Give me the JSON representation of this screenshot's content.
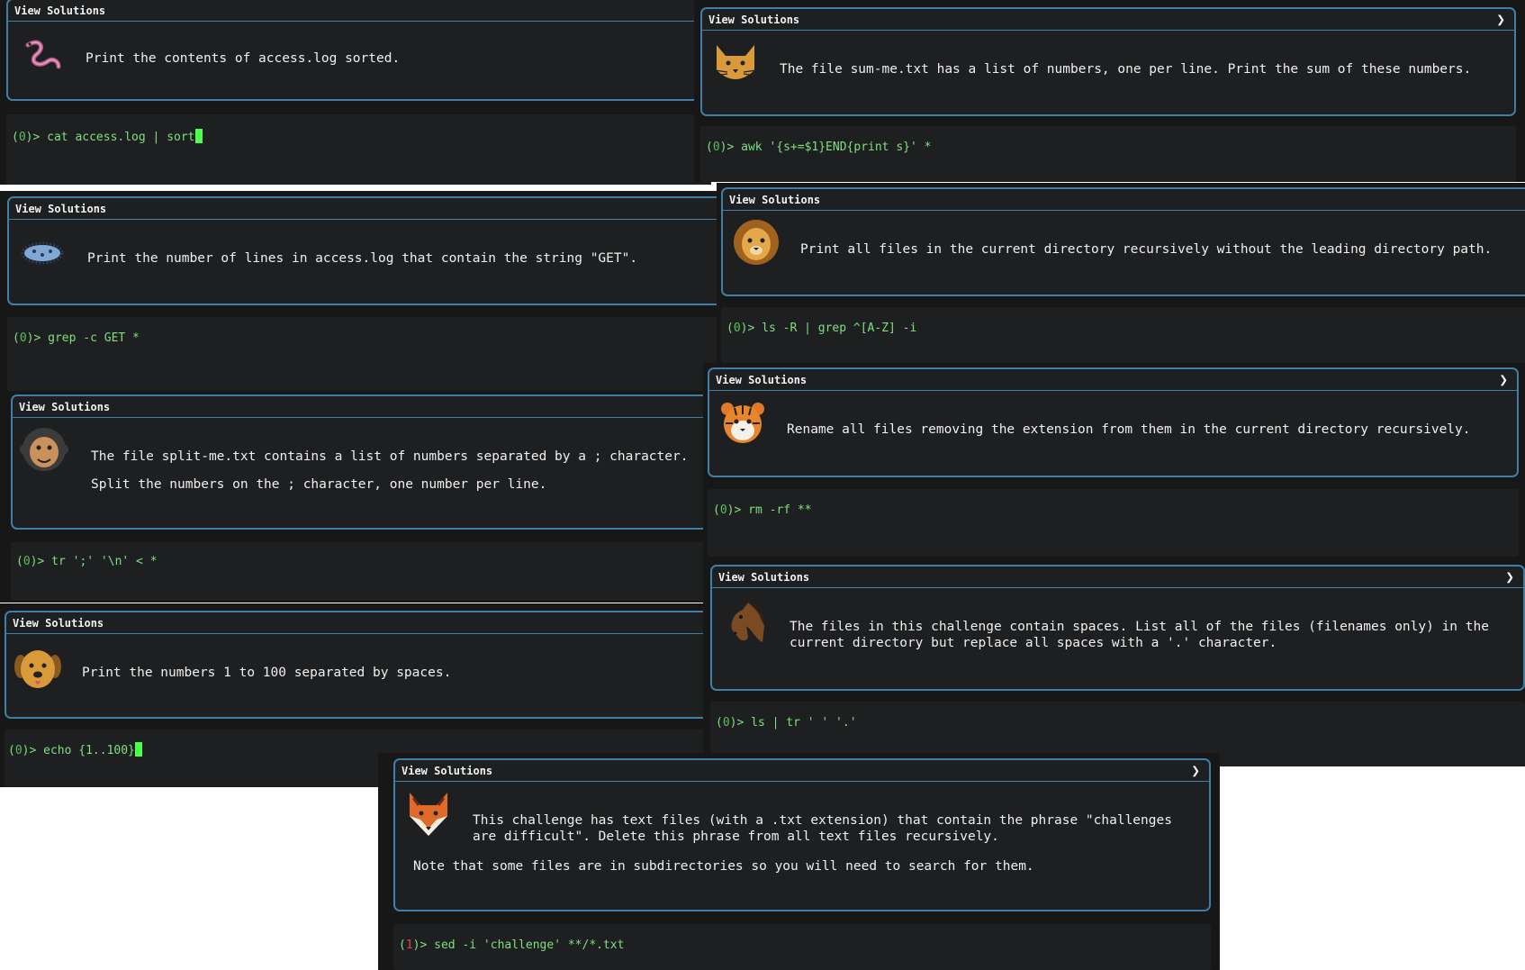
{
  "common": {
    "view_solutions": "View Solutions",
    "chevron": "❯"
  },
  "tiles": {
    "t1": {
      "icon": "worm-icon",
      "desc": "Print the contents of access.log sorted.",
      "prompt_open": "(",
      "code": "0",
      "prompt_close": ")> ",
      "command": "cat access.log | sort"
    },
    "t2": {
      "icon": "cat-icon",
      "desc": "The file sum-me.txt has a list of numbers, one per line. Print the sum of these numbers.",
      "prompt_open": "(",
      "code": "0",
      "prompt_close": ")> ",
      "command": "awk '{s+=$1}END{print s}' *"
    },
    "t3": {
      "icon": "microbe-icon",
      "desc": "Print the number of lines in access.log that contain the string \"GET\".",
      "prompt_open": "(",
      "code": "0",
      "prompt_close": ")> ",
      "command": "grep -c GET *"
    },
    "t4": {
      "icon": "lion-icon",
      "desc": "Print all files in the current directory recursively without the leading directory path.",
      "prompt_open": "(",
      "code": "0",
      "prompt_close": ")> ",
      "command": "ls -R | grep ^[A-Z] -i"
    },
    "t5": {
      "icon": "monkey-icon",
      "desc1": "The file split-me.txt contains a list of numbers separated by a ; character.",
      "desc2": "Split the numbers on the ; character, one number per line.",
      "prompt_open": "(",
      "code": "0",
      "prompt_close": ")> ",
      "command": "tr ';' '\\n' < *"
    },
    "t6": {
      "icon": "tiger-icon",
      "desc": "Rename all files removing the extension from them in the current directory recursively.",
      "prompt_open": "(",
      "code": "0",
      "prompt_close": ")> ",
      "command": "rm -rf **"
    },
    "t7": {
      "icon": "dog-icon",
      "desc": "Print the numbers 1 to 100 separated by spaces.",
      "prompt_open": "(",
      "code": "0",
      "prompt_close": ")> ",
      "command": "echo {1..100}"
    },
    "t8": {
      "icon": "horse-icon",
      "desc1": "The files in this challenge contain spaces. List all of the files (filenames only) in the",
      "desc2": "current directory but replace all spaces with a '.' character.",
      "prompt_open": "(",
      "code": "0",
      "prompt_close": ")> ",
      "command": "ls | tr ' ' '.'"
    },
    "t9": {
      "icon": "fox-icon",
      "desc1": "This challenge has text files (with a .txt extension) that contain the phrase \"challenges",
      "desc2": "are difficult\". Delete this phrase from all text files recursively.",
      "desc3": "Note that some files are in subdirectories so you will need to search for them.",
      "prompt_open": "(",
      "code": "1",
      "prompt_close": ")> ",
      "command": "sed -i 'challenge' **/*.txt"
    }
  }
}
